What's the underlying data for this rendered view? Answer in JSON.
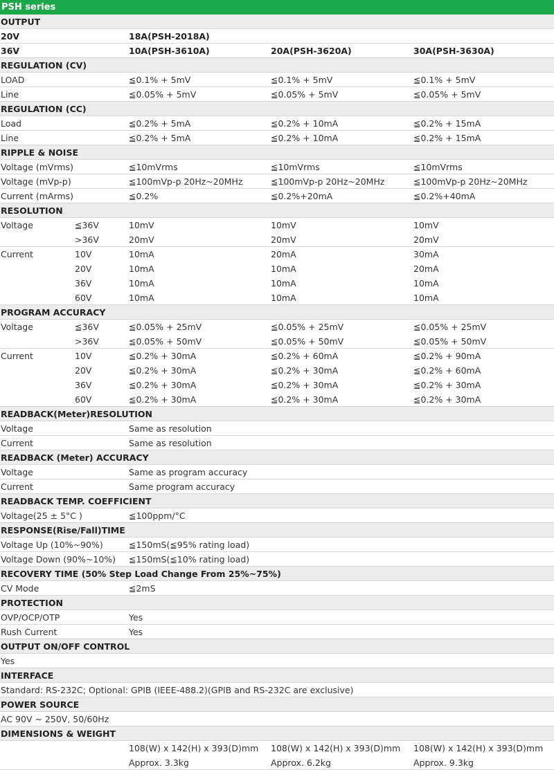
{
  "title": "PSH series",
  "rows": [
    {
      "type": "section",
      "cells": [
        "OUTPUT"
      ]
    },
    {
      "type": "bold",
      "cells": [
        "20V",
        "",
        "18A(PSH-2018A)",
        "",
        ""
      ]
    },
    {
      "type": "bold",
      "cells": [
        "36V",
        "",
        "10A(PSH-3610A)",
        "20A(PSH-3620A)",
        "30A(PSH-3630A)"
      ]
    },
    {
      "type": "section",
      "cells": [
        "REGULATION (CV)"
      ]
    },
    {
      "type": "data",
      "cells": [
        "LOAD",
        "",
        "≦0.1% + 5mV",
        "≦0.1% + 5mV",
        "≦0.1% + 5mV"
      ]
    },
    {
      "type": "data",
      "cells": [
        "Line",
        "",
        "≦0.05% + 5mV",
        "≦0.05% + 5mV",
        "≦0.05% + 5mV"
      ]
    },
    {
      "type": "section",
      "cells": [
        "REGULATION (CC)"
      ]
    },
    {
      "type": "data",
      "cells": [
        "Load",
        "",
        "≦0.2% + 5mA",
        "≦0.2% + 10mA",
        "≦0.2% + 15mA"
      ]
    },
    {
      "type": "data",
      "cells": [
        "Line",
        "",
        "≦0.2% + 5mA",
        "≦0.2% + 10mA",
        "≦0.2% + 15mA"
      ]
    },
    {
      "type": "section",
      "cells": [
        "RIPPLE & NOISE"
      ]
    },
    {
      "type": "data",
      "cells": [
        "Voltage (mVrms)",
        "",
        "≦10mVrms",
        "≦10mVrms",
        "≦10mVrms"
      ]
    },
    {
      "type": "data",
      "cells": [
        "Voltage (mVp-p)",
        "",
        "≦100mVp-p 20Hz~20MHz",
        "≦100mVp-p 20Hz~20MHz",
        "≦100mVp-p 20Hz~20MHz"
      ]
    },
    {
      "type": "data",
      "cells": [
        "Current (mArms)",
        "",
        "≦0.2%",
        "≦0.2%+20mA",
        "≦0.2%+40mA"
      ]
    },
    {
      "type": "section",
      "cells": [
        "RESOLUTION"
      ]
    },
    {
      "type": "data",
      "cells": [
        "Voltage",
        "≦36V",
        "10mV",
        "10mV",
        "10mV"
      ],
      "nb": true
    },
    {
      "type": "data",
      "cells": [
        "",
        ">36V",
        "20mV",
        "20mV",
        "20mV"
      ]
    },
    {
      "type": "data",
      "cells": [
        "Current",
        "10V",
        "10mA",
        "20mA",
        "30mA"
      ],
      "nb": true
    },
    {
      "type": "data",
      "cells": [
        "",
        "20V",
        "10mA",
        "10mA",
        "20mA"
      ],
      "nb": true
    },
    {
      "type": "data",
      "cells": [
        "",
        "36V",
        "10mA",
        "10mA",
        "10mA"
      ],
      "nb": true
    },
    {
      "type": "data",
      "cells": [
        "",
        "60V",
        "10mA",
        "10mA",
        "10mA"
      ]
    },
    {
      "type": "section",
      "cells": [
        "PROGRAM ACCURACY"
      ]
    },
    {
      "type": "data",
      "cells": [
        "Voltage",
        "≦36V",
        "≦0.05% + 25mV",
        "≦0.05% + 25mV",
        "≦0.05% + 25mV"
      ],
      "nb": true
    },
    {
      "type": "data",
      "cells": [
        "",
        ">36V",
        "≦0.05% + 50mV",
        "≦0.05% + 50mV",
        "≦0.05% + 50mV"
      ]
    },
    {
      "type": "data",
      "cells": [
        "Current",
        "10V",
        "≦0.2% + 30mA",
        "≦0.2% + 60mA",
        "≦0.2% + 90mA"
      ],
      "nb": true
    },
    {
      "type": "data",
      "cells": [
        "",
        "20V",
        "≦0.2% + 30mA",
        "≦0.2% + 30mA",
        "≦0.2% + 60mA"
      ],
      "nb": true
    },
    {
      "type": "data",
      "cells": [
        "",
        "36V",
        "≦0.2% + 30mA",
        "≦0.2% + 30mA",
        "≦0.2% + 30mA"
      ],
      "nb": true
    },
    {
      "type": "data",
      "cells": [
        "",
        "60V",
        "≦0.2% + 30mA",
        "≦0.2% + 30mA",
        "≦0.2% + 30mA"
      ]
    },
    {
      "type": "section",
      "cells": [
        "READBACK(Meter)RESOLUTION"
      ]
    },
    {
      "type": "data",
      "cells": [
        "Voltage",
        "",
        "Same as resolution",
        "",
        ""
      ]
    },
    {
      "type": "data",
      "cells": [
        "Current",
        "",
        "Same as resolution",
        "",
        ""
      ]
    },
    {
      "type": "section",
      "cells": [
        "READBACK (Meter) ACCURACY"
      ]
    },
    {
      "type": "data",
      "cells": [
        "Voltage",
        "",
        "Same as program accuracy",
        "",
        ""
      ]
    },
    {
      "type": "data",
      "cells": [
        "Current",
        "",
        "Same program accuracy",
        "",
        ""
      ]
    },
    {
      "type": "section",
      "cells": [
        "READBACK TEMP. COEFFICIENT"
      ]
    },
    {
      "type": "data",
      "cells": [
        "Voltage(25 ± 5°C )",
        "",
        "≦100ppm/°C",
        "",
        ""
      ]
    },
    {
      "type": "section",
      "cells": [
        "RESPONSE(Rise/Fall)TIME"
      ]
    },
    {
      "type": "data",
      "cells": [
        "Voltage Up (10%~90%)",
        "",
        "≦150mS(≦95% rating load)",
        "",
        ""
      ]
    },
    {
      "type": "data",
      "cells": [
        "Voltage Down (90%~10%)",
        "",
        "≦150mS(≦10% rating load)",
        "",
        ""
      ]
    },
    {
      "type": "section",
      "cells": [
        "RECOVERY TIME (50% Step Load Change From 25%~75%)"
      ]
    },
    {
      "type": "data",
      "cells": [
        "CV Mode",
        "",
        "≦2mS",
        "",
        ""
      ]
    },
    {
      "type": "section",
      "cells": [
        "PROTECTION"
      ]
    },
    {
      "type": "data",
      "cells": [
        "OVP/OCP/OTP",
        "",
        "Yes",
        "",
        ""
      ]
    },
    {
      "type": "data",
      "cells": [
        "Rush Current",
        "",
        "Yes",
        "",
        ""
      ]
    },
    {
      "type": "section",
      "cells": [
        "OUTPUT ON/OFF CONTROL"
      ]
    },
    {
      "type": "data",
      "cells": [
        "Yes"
      ]
    },
    {
      "type": "section",
      "cells": [
        "INTERFACE"
      ]
    },
    {
      "type": "data",
      "cells": [
        "Standard: RS-232C; Optional: GPIB (IEEE-488.2)(GPIB and RS-232C are exclusive)"
      ]
    },
    {
      "type": "section",
      "cells": [
        "POWER SOURCE"
      ]
    },
    {
      "type": "data",
      "cells": [
        "AC 90V ~ 250V, 50/60Hz"
      ]
    },
    {
      "type": "section",
      "cells": [
        "DIMENSIONS & WEIGHT"
      ]
    },
    {
      "type": "tall",
      "cells": [
        "",
        "",
        "108(W) x 142(H) x 393(D)mm",
        "108(W) x 142(H) x 393(D)mm",
        "108(W) x 142(H) x 393(D)mm"
      ],
      "cells2": [
        "",
        "",
        "Approx. 3.3kg",
        "Approx. 6.2kg",
        "Approx. 9.3kg"
      ]
    }
  ]
}
